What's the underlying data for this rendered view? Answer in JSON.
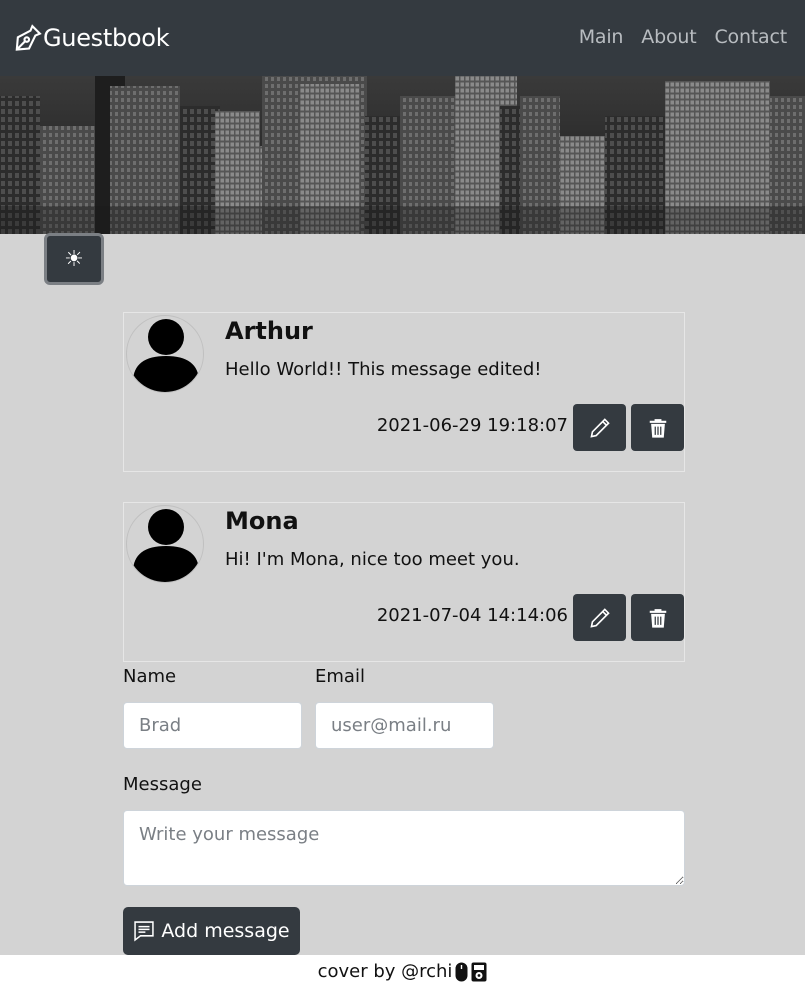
{
  "navbar": {
    "brand": "Guestbook",
    "brand_icon": "pen-nib-icon",
    "links": [
      "Main",
      "About",
      "Contact"
    ]
  },
  "theme_toggle": {
    "icon": "sun-icon",
    "glyph": "☀"
  },
  "messages": [
    {
      "name": "Arthur",
      "text": "Hello World!! This message edited!",
      "date": "2021-06-29 19:18:07"
    },
    {
      "name": "Mona",
      "text": "Hi! I'm Mona, nice too meet you.",
      "date": "2021-07-04 14:14:06"
    }
  ],
  "form": {
    "name_label": "Name",
    "name_placeholder": "Brad",
    "email_label": "Email",
    "email_placeholder": "user@mail.ru",
    "message_label": "Message",
    "message_placeholder": "Write your message",
    "submit_label": "Add message"
  },
  "footer": {
    "text": "cover by @rchi"
  },
  "colors": {
    "navbar": "#343a40",
    "page_bg": "#d3d3d3",
    "button": "#343a40"
  }
}
